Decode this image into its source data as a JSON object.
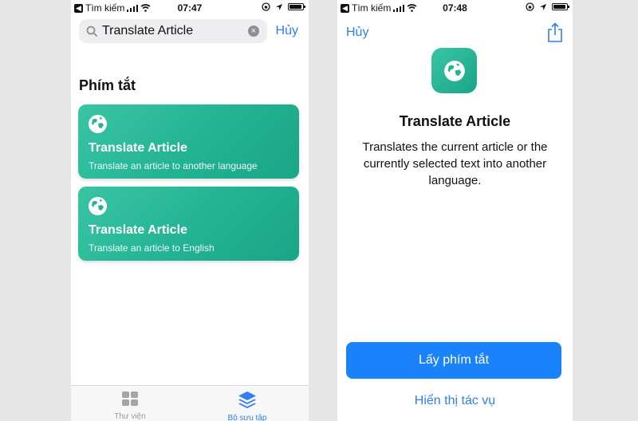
{
  "left_screen": {
    "status": {
      "carrier": "Tìm kiếm",
      "time": "07:47"
    },
    "search": {
      "value": "Translate Article",
      "cancel_label": "Hủy"
    },
    "section_title": "Phím tắt",
    "cards": [
      {
        "title": "Translate Article",
        "subtitle": "Translate an article to another language"
      },
      {
        "title": "Translate Article",
        "subtitle": "Translate an article to English"
      }
    ],
    "tabs": [
      {
        "label": "Thư viện",
        "icon": "grid-icon",
        "selected": false
      },
      {
        "label": "Bộ sưu tập",
        "icon": "layers-icon",
        "selected": true
      }
    ]
  },
  "right_screen": {
    "status": {
      "carrier": "Tìm kiếm",
      "time": "07:48"
    },
    "nav": {
      "cancel_label": "Hủy",
      "share_icon": "share-icon"
    },
    "title": "Translate Article",
    "description": "Translates the current article or the currently selected text into another language.",
    "primary_button": "Lấy phím tắt",
    "secondary_link": "Hiển thị tác vụ"
  },
  "colors": {
    "accent": "#2f7ef2",
    "button": "#1a82fb",
    "card_green": "#22b392"
  }
}
